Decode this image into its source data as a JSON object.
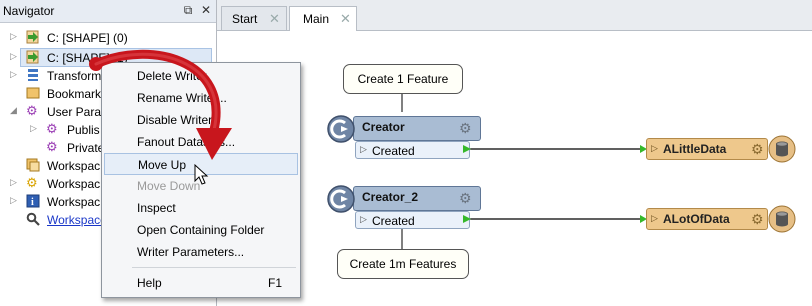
{
  "navigator": {
    "title": "Navigator",
    "float_glyph": "⧉",
    "close_glyph": "✕",
    "items": [
      {
        "label": "C: [SHAPE] (0)",
        "icon": "reader-arrow-icon"
      },
      {
        "label": "C: [SHAPE] (1)",
        "icon": "writer-arrow-icon"
      },
      {
        "label": "Transform",
        "icon": "transformer-icon"
      },
      {
        "label": "Bookmark",
        "icon": "bookmark-icon"
      },
      {
        "label": "User Param",
        "icon": "gear-icon"
      },
      {
        "label": "Publis",
        "icon": "gear-icon"
      },
      {
        "label": "Private",
        "icon": "gear-icon"
      },
      {
        "label": "Workspac",
        "icon": "workspace-icon"
      },
      {
        "label": "Workspac",
        "icon": "gear-icon"
      },
      {
        "label": "Workspac",
        "icon": "info-icon"
      },
      {
        "label": "Workspace",
        "icon": "search-icon"
      }
    ]
  },
  "tabs": [
    {
      "label": "Start",
      "close": "✕"
    },
    {
      "label": "Main",
      "close": "✕"
    }
  ],
  "canvas": {
    "bubble_top": "Create 1 Feature",
    "bubble_bottom": "Create 1m Features",
    "creator1": {
      "name": "Creator",
      "port": "Created"
    },
    "creator2": {
      "name": "Creator_2",
      "port": "Created"
    },
    "writer1": "ALittleData",
    "writer2": "ALotOfData"
  },
  "context_menu": {
    "items": [
      {
        "label": "Delete Writer",
        "shortcut": ""
      },
      {
        "label": "Rename Writer...",
        "shortcut": ""
      },
      {
        "label": "Disable Writer",
        "shortcut": ""
      },
      {
        "label": "Fanout Datasets...",
        "shortcut": ""
      },
      {
        "label": "Move Up",
        "shortcut": ""
      },
      {
        "label": "Move Down",
        "shortcut": ""
      },
      {
        "label": "Inspect",
        "shortcut": ""
      },
      {
        "label": "Open Containing Folder",
        "shortcut": ""
      },
      {
        "label": "Writer Parameters...",
        "shortcut": ""
      },
      {
        "label": "Help",
        "shortcut": "F1"
      }
    ],
    "highlighted": "Move Up",
    "disabled": "Move Down"
  },
  "colors": {
    "annotation_arrow": "#c8161d",
    "transformer_fill": "#a9bcd3",
    "writer_fill": "#eec88c",
    "connection": "#000000",
    "port_green": "#35b82a"
  }
}
